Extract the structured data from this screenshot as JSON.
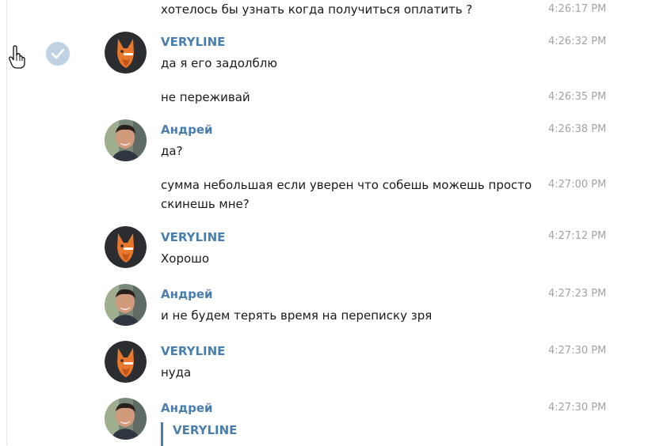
{
  "colors": {
    "name": "#4a7eae",
    "time": "#a3a3a3",
    "text": "#1a1a1a",
    "check_bg": "#bfd2e3"
  },
  "messages": [
    {
      "text_lines": [
        "хотелось бы узнать когда получиться оплатить ?"
      ],
      "time": "4:26:17 PM"
    },
    {
      "author": "VERYLINE",
      "text_lines": [
        "да я его задолблю"
      ],
      "time": "4:26:32 PM",
      "avatar": "fox-avatar"
    },
    {
      "text_lines": [
        "не переживай"
      ],
      "time": "4:26:35 PM"
    },
    {
      "author": "Андрей",
      "text_lines": [
        "да?"
      ],
      "time": "4:26:38 PM",
      "avatar": "man-avatar"
    },
    {
      "text_lines": [
        "сумма небольшая если уверен что собешь можешь просто",
        "скинешь мне?"
      ],
      "time": "4:27:00 PM"
    },
    {
      "author": "VERYLINE",
      "text_lines": [
        "Хорошо"
      ],
      "time": "4:27:12 PM",
      "avatar": "fox-avatar"
    },
    {
      "author": "Андрей",
      "text_lines": [
        "и не будем терять время на переписку зря"
      ],
      "time": "4:27:23 PM",
      "avatar": "man-avatar"
    },
    {
      "author": "VERYLINE",
      "text_lines": [
        "нуда"
      ],
      "time": "4:27:30 PM",
      "avatar": "fox-avatar"
    },
    {
      "author": "Андрей",
      "time": "4:27:30 PM",
      "avatar": "man-avatar",
      "reply": {
        "author": "VERYLINE"
      }
    }
  ],
  "icons": {
    "cursor": "hand-pointer-icon",
    "selection": "checkmark-icon"
  }
}
